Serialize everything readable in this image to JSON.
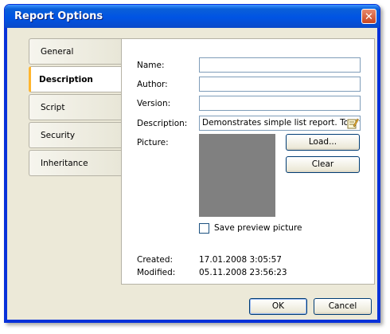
{
  "window": {
    "title": "Report Options",
    "close_symbol": "✕"
  },
  "tabs": [
    {
      "label": "General",
      "active": false
    },
    {
      "label": "Description",
      "active": true
    },
    {
      "label": "Script",
      "active": false
    },
    {
      "label": "Security",
      "active": false
    },
    {
      "label": "Inheritance",
      "active": false
    }
  ],
  "form": {
    "name_label": "Name:",
    "name_value": "",
    "author_label": "Author:",
    "author_value": "",
    "version_label": "Version:",
    "version_value": "",
    "description_label": "Description:",
    "description_value": "Demonstrates simple list report. To cr",
    "picture_label": "Picture:",
    "load_button": "Load...",
    "clear_button": "Clear",
    "save_preview_label": "Save preview picture",
    "save_preview_checked": false,
    "created_label": "Created:",
    "created_value": "17.01.2008 3:05:57",
    "modified_label": "Modified:",
    "modified_value": "05.11.2008 23:56:23"
  },
  "buttons": {
    "ok": "OK",
    "cancel": "Cancel"
  },
  "colors": {
    "title_bar": "#0054e3",
    "face": "#ece9d8",
    "picture_placeholder": "#808080",
    "active_tab_marker": "#ffb52e"
  }
}
